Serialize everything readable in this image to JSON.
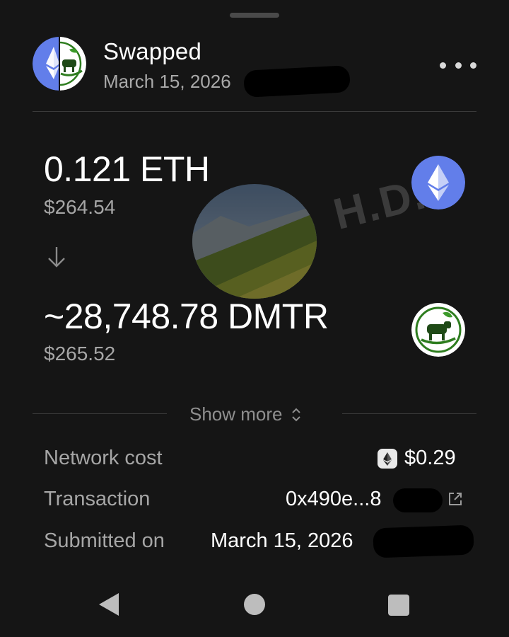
{
  "header": {
    "title": "Swapped",
    "date": "March 15, 2026",
    "avatar_icon": "eth-dmtr-split-icon",
    "more_icon": "more-dots-icon"
  },
  "swap": {
    "from": {
      "amount": "0.121 ETH",
      "usd": "$264.54",
      "icon": "ethereum-icon"
    },
    "to": {
      "amount": "~28,748.78 DMTR",
      "usd": "$265.52",
      "icon": "dmtr-cow-icon"
    },
    "direction_icon": "arrow-down-icon",
    "watermark": "H.D."
  },
  "show_more": {
    "label": "Show more",
    "icon": "chevron-up-down-icon"
  },
  "details": {
    "network_cost_label": "Network cost",
    "network_cost_value": "$0.29",
    "transaction_label": "Transaction",
    "transaction_value": "0x490e...8",
    "submitted_label": "Submitted on",
    "submitted_value": "March 15, 2026"
  },
  "colors": {
    "background": "#151515",
    "eth_blue": "#627EEA",
    "dmtr_green": "#2E7D1F",
    "muted_text": "#A6A6A6"
  }
}
